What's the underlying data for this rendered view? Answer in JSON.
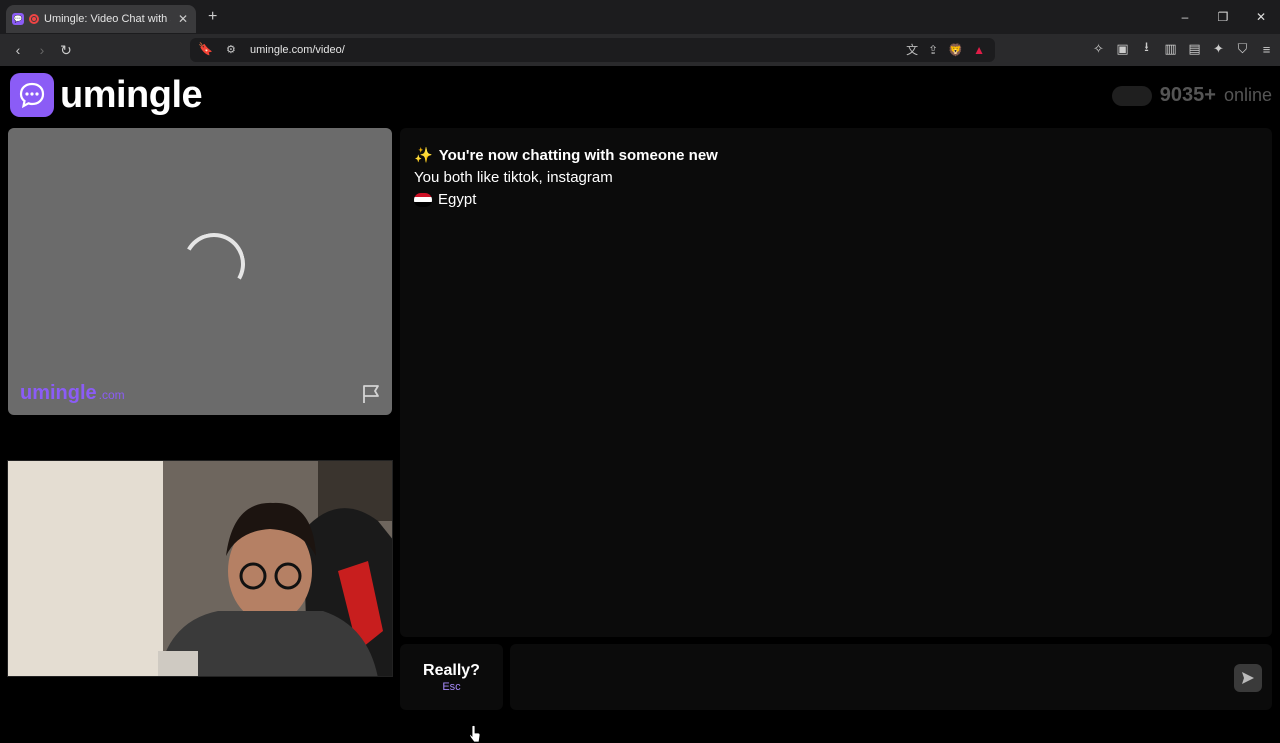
{
  "browser": {
    "tab_title": "Umingle: Video Chat with Stra",
    "tab_close": "✕",
    "new_tab": "+",
    "url": "umingle.com/video/",
    "window_controls": [
      "–",
      "❐",
      "✕"
    ]
  },
  "header": {
    "logo_text": "umingle",
    "online_count": "9035+",
    "online_label": "online"
  },
  "stranger_video": {
    "watermark": "umingle",
    "watermark_domain": ".com"
  },
  "chat": {
    "system_message": "You're now chatting with someone new",
    "interests": "You both like tiktok, instagram",
    "country": "Egypt",
    "sparkle": "✨"
  },
  "controls": {
    "esc_label": "Really?",
    "esc_hint": "Esc",
    "input_value": "",
    "input_placeholder": ""
  },
  "colors": {
    "brand": "#8b5cf6",
    "background": "#000000",
    "panel": "#0b0b0b"
  }
}
